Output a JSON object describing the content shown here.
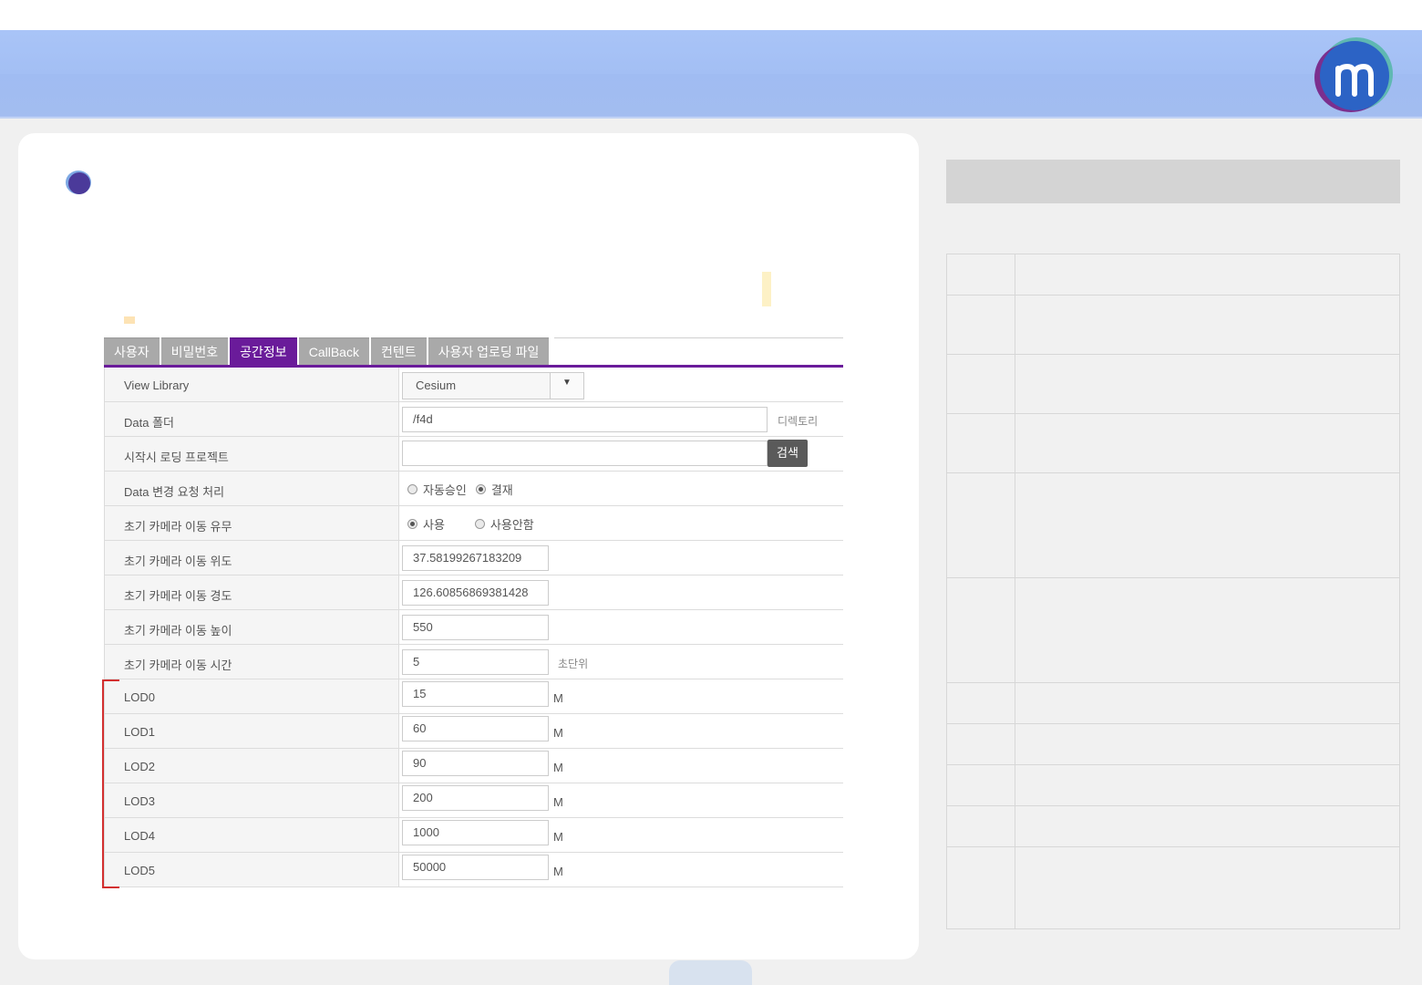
{
  "tabs": [
    {
      "label": "사용자",
      "active": false
    },
    {
      "label": "비밀번호",
      "active": false
    },
    {
      "label": "공간정보",
      "active": true
    },
    {
      "label": "CallBack",
      "active": false
    },
    {
      "label": "컨텐트",
      "active": false
    },
    {
      "label": "사용자 업로딩 파일",
      "active": false
    }
  ],
  "form": {
    "view_library": {
      "label": "View Library",
      "value": "Cesium"
    },
    "data_folder": {
      "label": "Data 폴더",
      "value": "/f4d",
      "note": "디렉토리"
    },
    "start_project": {
      "label": "시작시 로딩 프로젝트",
      "value": "",
      "button": "검색"
    },
    "data_change": {
      "label": "Data 변경 요청 처리",
      "options": [
        "자동승인",
        "결재"
      ],
      "selected": "결재"
    },
    "camera_move": {
      "label": "초기 카메라 이동 유무",
      "options": [
        "사용",
        "사용안함"
      ],
      "selected": "사용"
    },
    "camera_lat": {
      "label": "초기 카메라 이동 위도",
      "value": "37.58199267183209"
    },
    "camera_lon": {
      "label": "초기 카메라 이동 경도",
      "value": "126.60856869381428"
    },
    "camera_height": {
      "label": "초기 카메라 이동 높이",
      "value": "550"
    },
    "camera_time": {
      "label": "초기 카메라 이동 시간",
      "value": "5",
      "note": "초단위"
    },
    "lod": [
      {
        "label": "LOD0",
        "value": "15",
        "unit": "M"
      },
      {
        "label": "LOD1",
        "value": "60",
        "unit": "M"
      },
      {
        "label": "LOD2",
        "value": "90",
        "unit": "M"
      },
      {
        "label": "LOD3",
        "value": "200",
        "unit": "M"
      },
      {
        "label": "LOD4",
        "value": "1000",
        "unit": "M"
      },
      {
        "label": "LOD5",
        "value": "50000",
        "unit": "M"
      }
    ]
  },
  "colors": {
    "accent": "#6a1b9a",
    "header": "#a6c1f5",
    "highlight": "#d32f2f"
  }
}
